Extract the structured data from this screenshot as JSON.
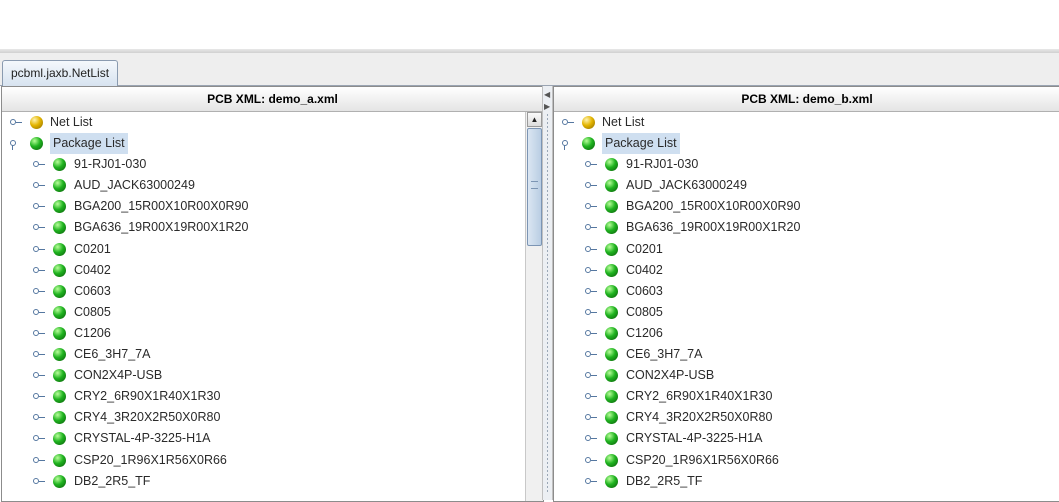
{
  "tab": {
    "label": "pcbml.jaxb.NetList"
  },
  "left_panel": {
    "title": "PCB XML: demo_a.xml",
    "net_list": "Net List",
    "package_list": "Package List",
    "packages": [
      "91-RJ01-030",
      "AUD_JACK63000249",
      "BGA200_15R00X10R00X0R90",
      "BGA636_19R00X19R00X1R20",
      "C0201",
      "C0402",
      "C0603",
      "C0805",
      "C1206",
      "CE6_3H7_7A",
      "CON2X4P-USB",
      "CRY2_6R90X1R40X1R30",
      "CRY4_3R20X2R50X0R80",
      "CRYSTAL-4P-3225-H1A",
      "CSP20_1R96X1R56X0R66",
      "DB2_2R5_TF"
    ]
  },
  "right_panel": {
    "title": "PCB XML: demo_b.xml",
    "net_list": "Net List",
    "package_list": "Package List",
    "packages": [
      "91-RJ01-030",
      "AUD_JACK63000249",
      "BGA200_15R00X10R00X0R90",
      "BGA636_19R00X19R00X1R20",
      "C0201",
      "C0402",
      "C0603",
      "C0805",
      "C1206",
      "CE6_3H7_7A",
      "CON2X4P-USB",
      "CRY2_6R90X1R40X1R30",
      "CRY4_3R20X2R50X0R80",
      "CRYSTAL-4P-3225-H1A",
      "CSP20_1R96X1R56X0R66",
      "DB2_2R5_TF"
    ]
  },
  "icons": {
    "collapsed": "tree-collapsed-handle-icon",
    "expanded": "tree-expanded-handle-icon",
    "net_node": "gold-ball-icon",
    "package_node": "green-ball-icon"
  },
  "colors": {
    "selection": "#cfdff0",
    "gold_node": "#e3b400",
    "green_node": "#1fb31f"
  }
}
